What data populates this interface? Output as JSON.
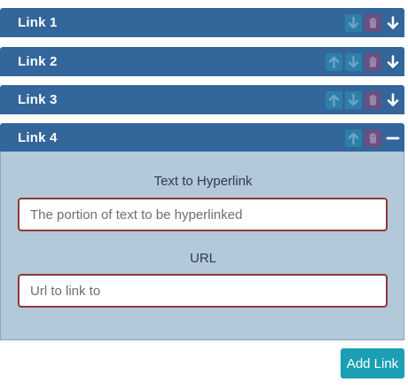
{
  "links": [
    {
      "title": "Link 1",
      "controls": [
        "arrow-down-icon",
        "trash-icon"
      ],
      "toggle": "arrow-down-icon",
      "expanded": false
    },
    {
      "title": "Link 2",
      "controls": [
        "arrow-up-icon",
        "arrow-down-icon",
        "trash-icon"
      ],
      "toggle": "arrow-down-icon",
      "expanded": false
    },
    {
      "title": "Link 3",
      "controls": [
        "arrow-up-icon",
        "arrow-down-icon",
        "trash-icon"
      ],
      "toggle": "arrow-down-icon",
      "expanded": false
    },
    {
      "title": "Link 4",
      "controls": [
        "arrow-up-icon",
        "trash-icon"
      ],
      "toggle": "minus-icon",
      "expanded": true
    }
  ],
  "form": {
    "text_label": "Text to Hyperlink",
    "text_placeholder": "The portion of text to be hyperlinked",
    "text_value": "",
    "url_label": "URL",
    "url_placeholder": "Url to link to",
    "url_value": ""
  },
  "add_button_label": "Add Link",
  "colors": {
    "header": "#33669a",
    "body": "#b3c8d8",
    "input_border": "#8b3a3a",
    "button": "#1c9fb5",
    "move_button": "#2e7fa8",
    "delete_button": "#6a4f82"
  }
}
